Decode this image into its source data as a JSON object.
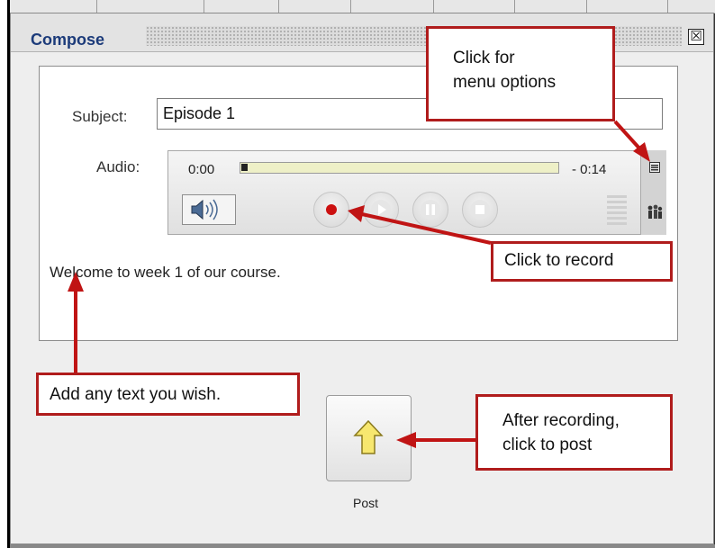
{
  "window": {
    "title": "Compose",
    "close_glyph": "☒"
  },
  "form": {
    "subject_label": "Subject:",
    "subject_value": "Episode 1",
    "audio_label": "Audio:",
    "body_text": "Welcome to week 1 of our course."
  },
  "player": {
    "elapsed": "0:00",
    "remaining": "- 0:14",
    "progress_fraction": 0.0,
    "controls": [
      "record",
      "play",
      "pause",
      "stop"
    ],
    "icons": [
      "speaker-icon",
      "menu-icon",
      "people-icon",
      "level-meter-icon"
    ]
  },
  "post": {
    "label": "Post"
  },
  "callouts": {
    "menu_line1": "Click for",
    "menu_line2": "menu options",
    "record": "Click to record",
    "text": "Add any text you wish.",
    "post_line1": "After recording,",
    "post_line2": "click to post"
  },
  "colors": {
    "callout_border": "#b01c1c",
    "record_dot": "#cc1111",
    "title_text": "#1c3b7a",
    "arrow": "#c01414"
  }
}
